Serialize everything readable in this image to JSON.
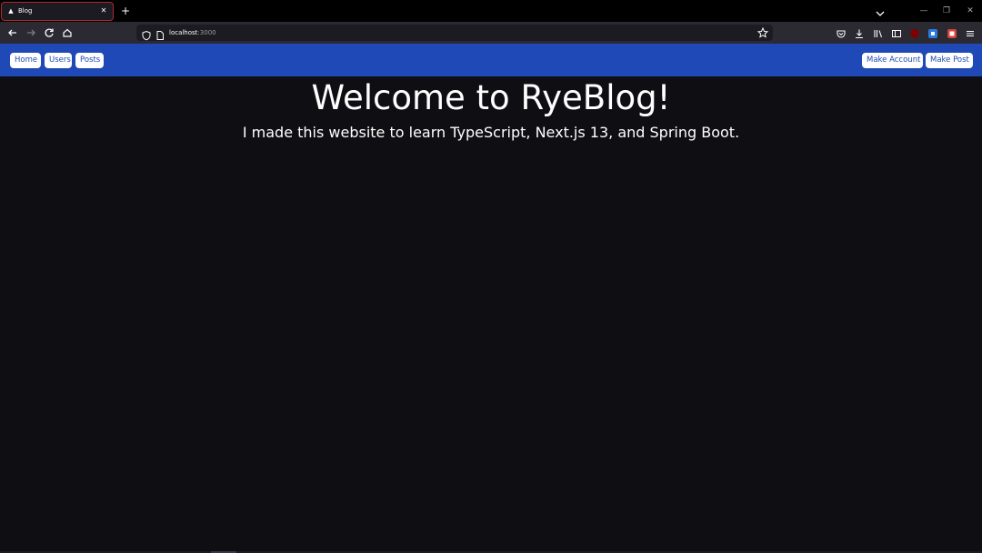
{
  "browser": {
    "tab": {
      "title": "Blog",
      "favicon": "triangle-favicon",
      "close_glyph": "✕"
    },
    "new_tab_glyph": "+",
    "url": {
      "host": "localhost",
      "port": ":3000"
    },
    "window_controls": {
      "minimize": "—",
      "restore": "❐",
      "close": "✕"
    }
  },
  "site": {
    "nav_left": [
      "Home",
      "Users",
      "Posts"
    ],
    "nav_right": [
      "Make Account",
      "Make Post"
    ],
    "title": "Welcome to RyeBlog!",
    "subtitle": "I made this website to learn TypeScript, Next.js 13, and Spring Boot."
  },
  "colors": {
    "nav_blue": "#1f49b6",
    "page_bg": "#0f0e12",
    "tab_highlight": "#b3262f"
  }
}
